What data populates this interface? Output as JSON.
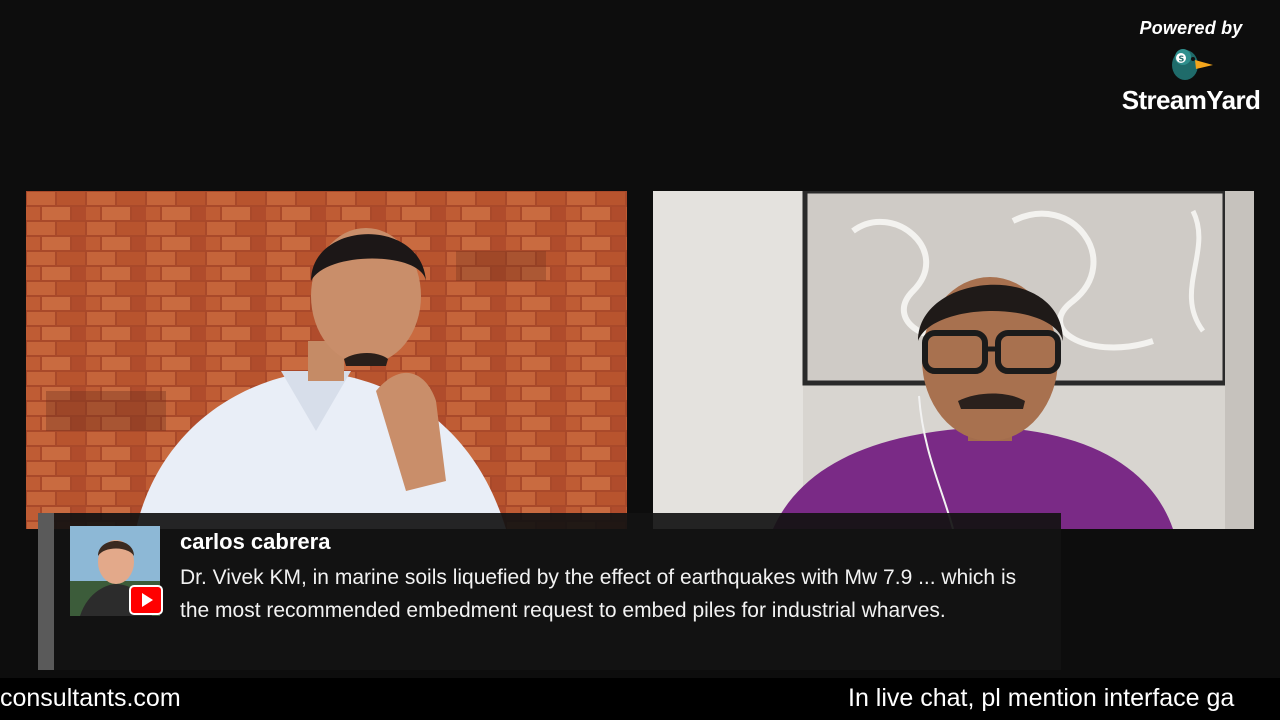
{
  "branding": {
    "powered_by": "Powered by",
    "product_name_part1": "Stream",
    "product_name_part2": "Yard",
    "logo_icon": "duck-logo-icon"
  },
  "participants": [
    {
      "position": "left",
      "background": "brick-wall"
    },
    {
      "position": "right",
      "background": "light-wall-with-frame"
    }
  ],
  "comment": {
    "author": "carlos cabrera",
    "source_icon": "youtube-icon",
    "message": "Dr. Vivek KM, in marine soils liquefied by the effect of earthquakes with Mw 7.9 ... which is the most recommended embedment request to embed piles for industrial wharves."
  },
  "ticker": {
    "left_text": "consultants.com",
    "right_text": "In live chat, pl mention interface ga"
  },
  "colors": {
    "background": "#0d0d0d",
    "youtube_red": "#ff0000",
    "brick": "#b6502a"
  }
}
